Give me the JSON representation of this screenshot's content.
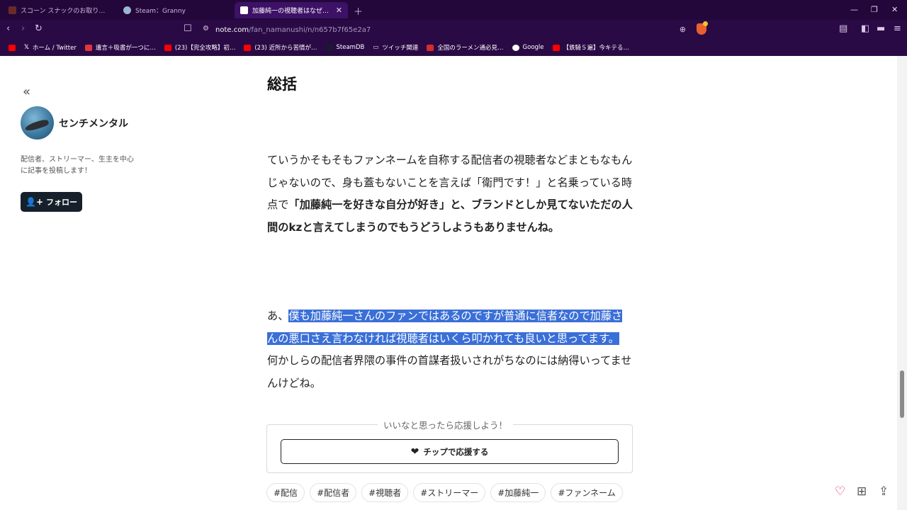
{
  "browser": {
    "tabs": [
      {
        "title": "スコーン スナックのお取り寄せ | 公式通販",
        "active": false,
        "favicon_color": "#6b2a2a"
      },
      {
        "title": "Steam：Granny",
        "active": false,
        "favicon_color": "#9bb6d0"
      },
      {
        "title": "加藤純一の視聴者はなぜ嫌われて",
        "active": true,
        "favicon_color": "#ffffff"
      }
    ],
    "new_tab_icon": "plus-icon",
    "url_host": "note.com",
    "url_path": "/fan_namanushi/n/n657b7f65e2a7",
    "bookmarks": [
      {
        "label": "",
        "icon": "youtube-icon",
        "color": "#ff0000"
      },
      {
        "label": "ホーム / Twitter",
        "icon": "x-icon",
        "color": "#ffffff"
      },
      {
        "label": "遺言＋吸書が一つに…",
        "icon": "bookmark-icon",
        "color": "#e5343f"
      },
      {
        "label": "(23)【完全攻略】初…",
        "icon": "youtube-icon",
        "color": "#ff0000"
      },
      {
        "label": "(23) 近所から苦情が…",
        "icon": "youtube-icon",
        "color": "#ff0000"
      },
      {
        "label": "SteamDB",
        "icon": "steamdb-icon",
        "color": "#1a1a2e"
      },
      {
        "label": "ツイッチ関連",
        "icon": "folder-icon",
        "color": "#cccccc"
      },
      {
        "label": "全国のラーメン通必見…",
        "icon": "ramen-icon",
        "color": "#d92b2b"
      },
      {
        "label": "Google",
        "icon": "google-icon",
        "color": "#ffffff"
      },
      {
        "label": "【鉄騎５遍】今キテる…",
        "icon": "youtube-icon",
        "color": "#ff0000"
      }
    ]
  },
  "sidebar": {
    "collapse_icon": "double-chevron-left-icon",
    "author_name": "センチメンタル",
    "bio": "配信者、ストリーマー、生主を中心に記事を投稿します！",
    "follow_label": "フォロー"
  },
  "article": {
    "heading": "総括",
    "p1_normal": "ていうかそもそもファンネームを自称する配信者の視聴者などまともなもんじゃないので、身も蓋もないことを言えば「衛門です！」と名乗っている時点で",
    "p1_bold": "「加藤純一を好きな自分が好き」と、ブランドとしか見てないただの人間のkzと言えてしまうのでもうどうしようもありませんね。",
    "p2_prefix": "あ、",
    "p2_selected": "僕も加藤純一さんのファンではあるのですが普通に信者なので加藤さんの悪口さえ言わなければ視聴者はいくら叩かれても良いと思ってます。",
    "p2_rest": "何かしらの配信者界隈の事件の首謀者扱いされがちなのには納得いってませんけどね。"
  },
  "support": {
    "caption": "いいなと思ったら応援しよう！",
    "tip_label": "チップで応援する",
    "tip_icon": "heart-coin-icon"
  },
  "tags": [
    "#配信",
    "#配信者",
    "#視聴者",
    "#ストリーマー",
    "#加藤純一",
    "#ファンネーム"
  ],
  "actions": {
    "like_icon": "heart-icon",
    "magazine_icon": "magazine-add-icon",
    "share_icon": "share-icon"
  }
}
